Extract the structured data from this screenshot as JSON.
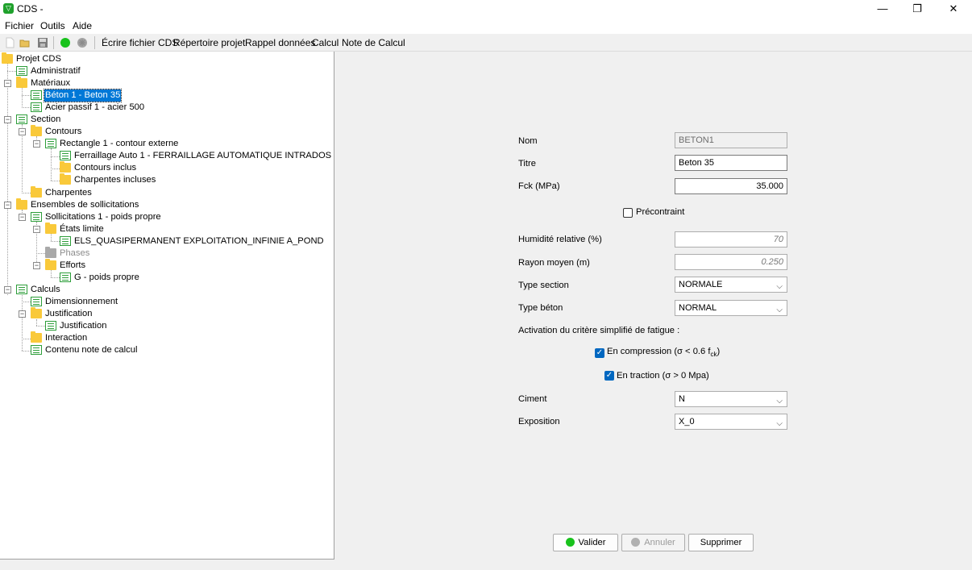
{
  "window": {
    "title": "CDS -",
    "app_icon": "cds-shield-icon",
    "controls": {
      "minimize": "—",
      "maximize": "❐",
      "close": "✕"
    }
  },
  "menu": [
    "Fichier",
    "Outils",
    "Aide"
  ],
  "toolbar": {
    "icons": [
      "new-file-icon",
      "open-folder-icon",
      "save-icon",
      "status-green-icon",
      "status-grey-icon"
    ],
    "actions": [
      "Écrire fichier CDS",
      "Répertoire projet",
      "Rappel données",
      "Calcul",
      "Note de Calcul"
    ]
  },
  "tree": [
    {
      "label": "Projet CDS",
      "icon": "folder"
    },
    {
      "label": "Administratif",
      "icon": "form"
    },
    {
      "label": "Matériaux",
      "icon": "folder"
    },
    {
      "label": "Béton 1 - Beton 35",
      "icon": "form",
      "selected": true
    },
    {
      "label": "Acier passif 1 - acier 500",
      "icon": "form"
    },
    {
      "label": "Section",
      "icon": "form"
    },
    {
      "label": "Contours",
      "icon": "folder"
    },
    {
      "label": "Rectangle 1 - contour externe",
      "icon": "form"
    },
    {
      "label": "Ferraillage Auto 1 - FERRAILLAGE AUTOMATIQUE INTRADOS",
      "icon": "form"
    },
    {
      "label": "Contours inclus",
      "icon": "folder"
    },
    {
      "label": "Charpentes incluses",
      "icon": "folder"
    },
    {
      "label": "Charpentes",
      "icon": "folder"
    },
    {
      "label": "Ensembles de sollicitations",
      "icon": "folder"
    },
    {
      "label": "Sollicitations 1 - poids propre",
      "icon": "form"
    },
    {
      "label": "États limite",
      "icon": "folder"
    },
    {
      "label": "ELS_QUASIPERMANENT EXPLOITATION_INFINIE A_POND",
      "icon": "form"
    },
    {
      "label": "Phases",
      "icon": "folder-grey",
      "disabled": true
    },
    {
      "label": "Efforts",
      "icon": "folder"
    },
    {
      "label": "G - poids propre",
      "icon": "form"
    },
    {
      "label": "Calculs",
      "icon": "form"
    },
    {
      "label": "Dimensionnement",
      "icon": "form"
    },
    {
      "label": "Justification",
      "icon": "folder"
    },
    {
      "label": "Justification",
      "icon": "form"
    },
    {
      "label": "Interaction",
      "icon": "folder"
    },
    {
      "label": "Contenu note de calcul",
      "icon": "form"
    }
  ],
  "form": {
    "nom": {
      "label": "Nom",
      "value": "BETON1"
    },
    "titre": {
      "label": "Titre",
      "value": "Beton 35"
    },
    "fck": {
      "label": "Fck (MPa)",
      "value": "35.000"
    },
    "precontraint": {
      "label": "Précontraint",
      "checked": false
    },
    "humidite": {
      "label": "Humidité relative (%)",
      "value": "70"
    },
    "rayon": {
      "label": "Rayon moyen (m)",
      "value": "0.250"
    },
    "type_section": {
      "label": "Type section",
      "value": "NORMALE"
    },
    "type_beton": {
      "label": "Type béton",
      "value": "NORMAL"
    },
    "fatigue_heading": "Activation du critère simplifié de fatigue :",
    "compression": {
      "label": "En compression (σ < 0.6 f",
      "sub": "ck",
      "suffix": ")",
      "checked": true
    },
    "traction": {
      "label": "En traction (σ > 0 Mpa)",
      "checked": true
    },
    "ciment": {
      "label": "Ciment",
      "value": "N"
    },
    "exposition": {
      "label": "Exposition",
      "value": "X_0"
    }
  },
  "buttons": {
    "valider": "Valider",
    "annuler": "Annuler",
    "supprimer": "Supprimer"
  },
  "colors": {
    "selection": "#0078d7",
    "ok_green": "#18c21c",
    "folder": "#f9c93a",
    "form_icon": "#2d9e3a"
  }
}
